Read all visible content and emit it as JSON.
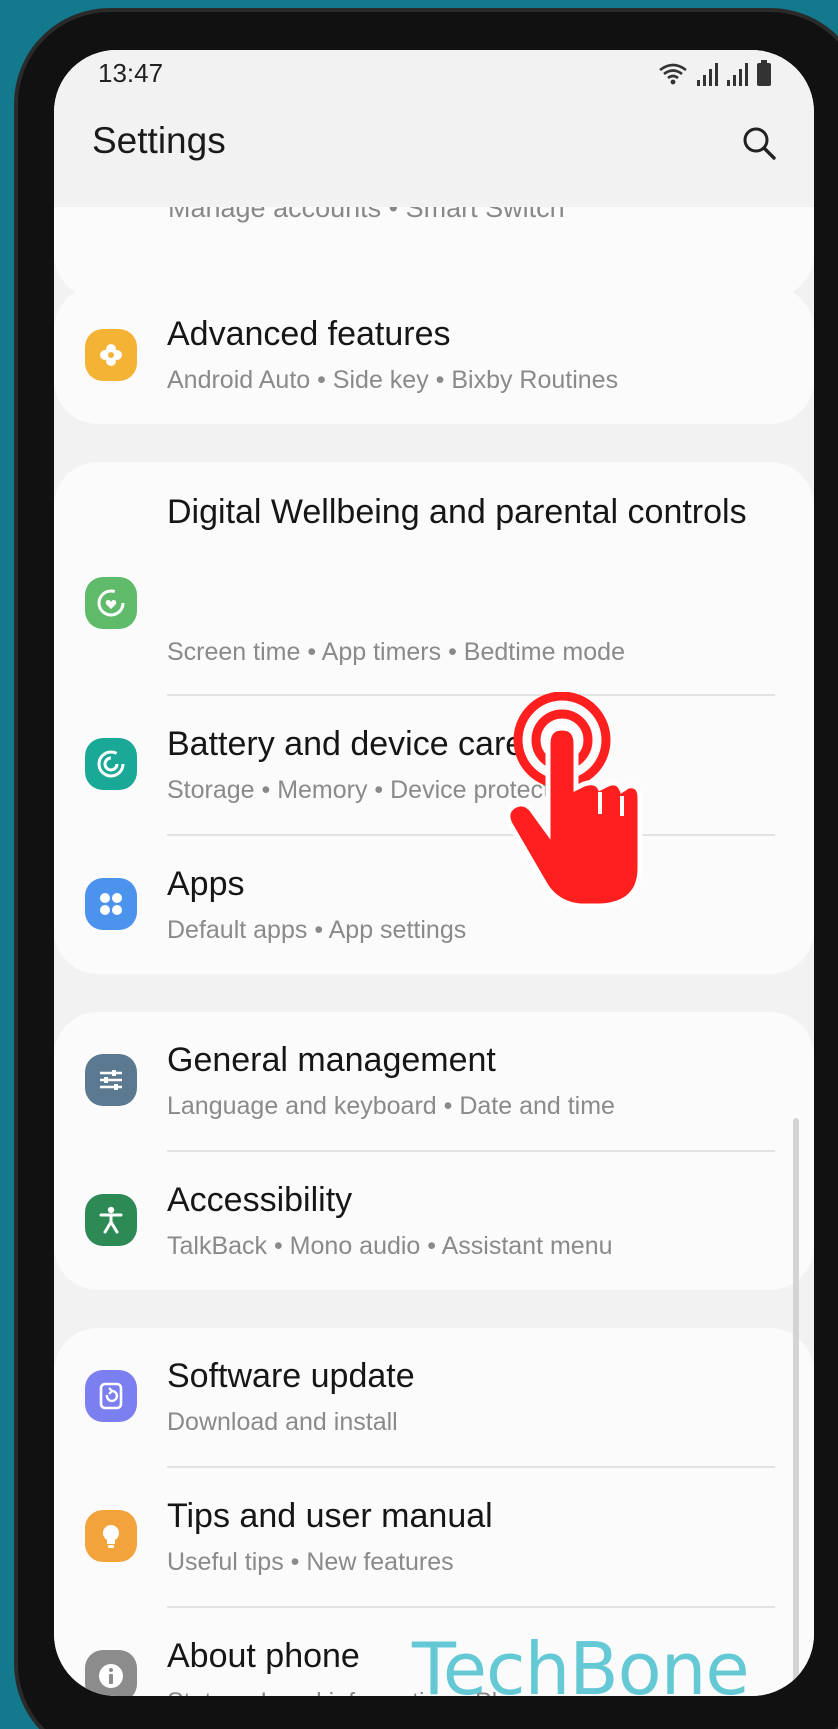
{
  "status_bar": {
    "time": "13:47"
  },
  "header": {
    "title": "Settings"
  },
  "partial_item": {
    "subtitle": "Manage accounts  •  Smart Switch"
  },
  "items": [
    {
      "title": "Advanced features",
      "subtitle": "Android Auto  •  Side key  •  Bixby Routines",
      "icon": "puzzle-icon",
      "color": "#f5b335"
    },
    {
      "title": "Digital Wellbeing and parental controls",
      "subtitle": "Screen time  •  App timers  •  Bedtime mode",
      "icon": "wellbeing-icon",
      "color": "#5fba6a"
    },
    {
      "title": "Battery and device care",
      "subtitle": "Storage  •  Memory  •  Device protection",
      "icon": "device-care-icon",
      "color": "#1aa897"
    },
    {
      "title": "Apps",
      "subtitle": "Default apps  •  App settings",
      "icon": "apps-grid-icon",
      "color": "#4c93ee"
    },
    {
      "title": "General management",
      "subtitle": "Language and keyboard  •  Date and time",
      "icon": "sliders-icon",
      "color": "#5b7a91"
    },
    {
      "title": "Accessibility",
      "subtitle": "TalkBack  •  Mono audio  •  Assistant menu",
      "icon": "accessibility-icon",
      "color": "#2e8a55"
    },
    {
      "title": "Software update",
      "subtitle": "Download and install",
      "icon": "update-icon",
      "color": "#7b7ff0"
    },
    {
      "title": "Tips and user manual",
      "subtitle": "Useful tips  •  New features",
      "icon": "lightbulb-icon",
      "color": "#f3a33b"
    },
    {
      "title": "About phone",
      "subtitle": "Status  •  Legal information  •  Phone name",
      "icon": "info-icon",
      "color": "#8c8c8c"
    }
  ],
  "watermark": "TechBone",
  "colors": {
    "background": "#127a8c",
    "screen": "#f2f2f2",
    "card": "#fbfbfb",
    "tap_hand": "#ff1f1f"
  }
}
